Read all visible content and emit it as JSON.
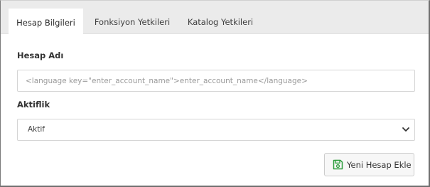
{
  "tabs": [
    {
      "label": "Hesap Bilgileri",
      "active": true
    },
    {
      "label": "Fonksiyon Yetkileri",
      "active": false
    },
    {
      "label": "Katalog Yetkileri",
      "active": false
    }
  ],
  "form": {
    "account_label": "Hesap Adı",
    "account_placeholder": "<language key=\"enter_account_name\">enter_account_name</language>",
    "status_label": "Aktiflik",
    "status_value": "Aktif"
  },
  "actions": {
    "add_label": "Yeni Hesap Ekle",
    "add_icon": "floppy-save-icon",
    "add_icon_color": "#2e9e3e"
  },
  "icons": {
    "select_chevron": "chevron-down-icon"
  }
}
